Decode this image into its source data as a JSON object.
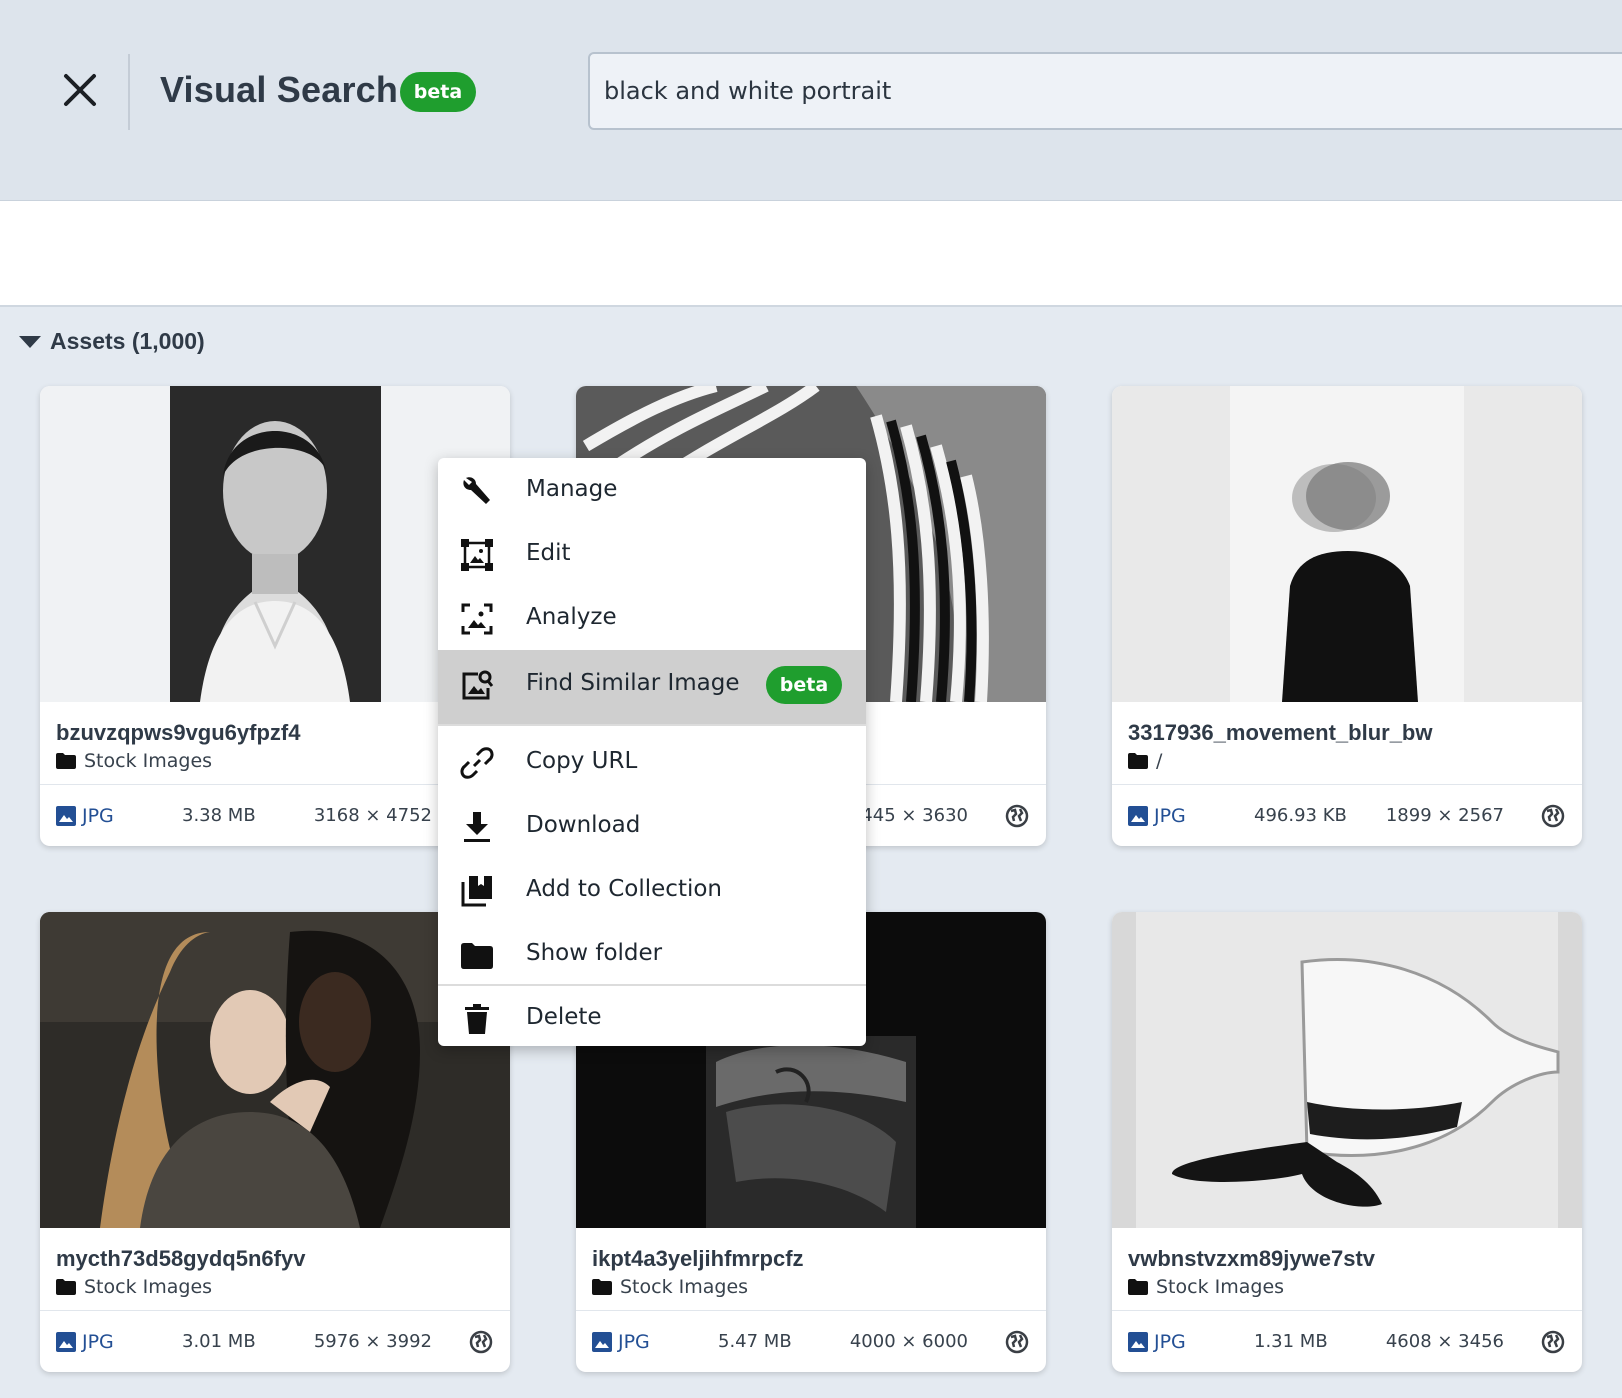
{
  "header": {
    "title": "Visual Search",
    "title_badge": "beta",
    "search_value": "black and white portrait"
  },
  "section": {
    "title": "Assets (1,000)"
  },
  "cards": [
    {
      "name": "bzuvzqpws9vgu6yfpzf4",
      "folder": "Stock Images",
      "type": "JPG",
      "size": "3.38 MB",
      "dims": "3168 × 4752"
    },
    {
      "name": "",
      "folder": "",
      "type": "",
      "size": "",
      "dims": "5445 × 3630"
    },
    {
      "name": "3317936_movement_blur_bw",
      "folder": "/",
      "type": "JPG",
      "size": "496.93 KB",
      "dims": "1899 × 2567"
    },
    {
      "name": "mycth73d58gydq5n6fyv",
      "folder": "Stock Images",
      "type": "JPG",
      "size": "3.01 MB",
      "dims": "5976 × 3992"
    },
    {
      "name": "ikpt4a3yeljihfmrpcfz",
      "folder": "Stock Images",
      "type": "JPG",
      "size": "5.47 MB",
      "dims": "4000 × 6000"
    },
    {
      "name": "vwbnstvzxm89jywe7stv",
      "folder": "Stock Images",
      "type": "JPG",
      "size": "1.31 MB",
      "dims": "4608 × 3456"
    }
  ],
  "context_menu": {
    "items": [
      {
        "label": "Manage",
        "icon": "wrench-icon"
      },
      {
        "label": "Edit",
        "icon": "crop-edit-icon"
      },
      {
        "label": "Analyze",
        "icon": "analyze-image-icon"
      },
      {
        "label": "Find Similar Image",
        "icon": "image-search-icon",
        "badge": "beta",
        "highlighted": true
      },
      {
        "label": "Copy URL",
        "icon": "link-icon"
      },
      {
        "label": "Download",
        "icon": "download-icon"
      },
      {
        "label": "Add to Collection",
        "icon": "collection-icon"
      },
      {
        "label": "Show folder",
        "icon": "folder-icon"
      },
      {
        "label": "Delete",
        "icon": "trash-icon"
      }
    ]
  },
  "colors": {
    "accent_green": "#1f9e2e",
    "file_type_blue": "#234f94",
    "header_bg": "#dde4ec",
    "page_bg": "#e4eaf1"
  }
}
